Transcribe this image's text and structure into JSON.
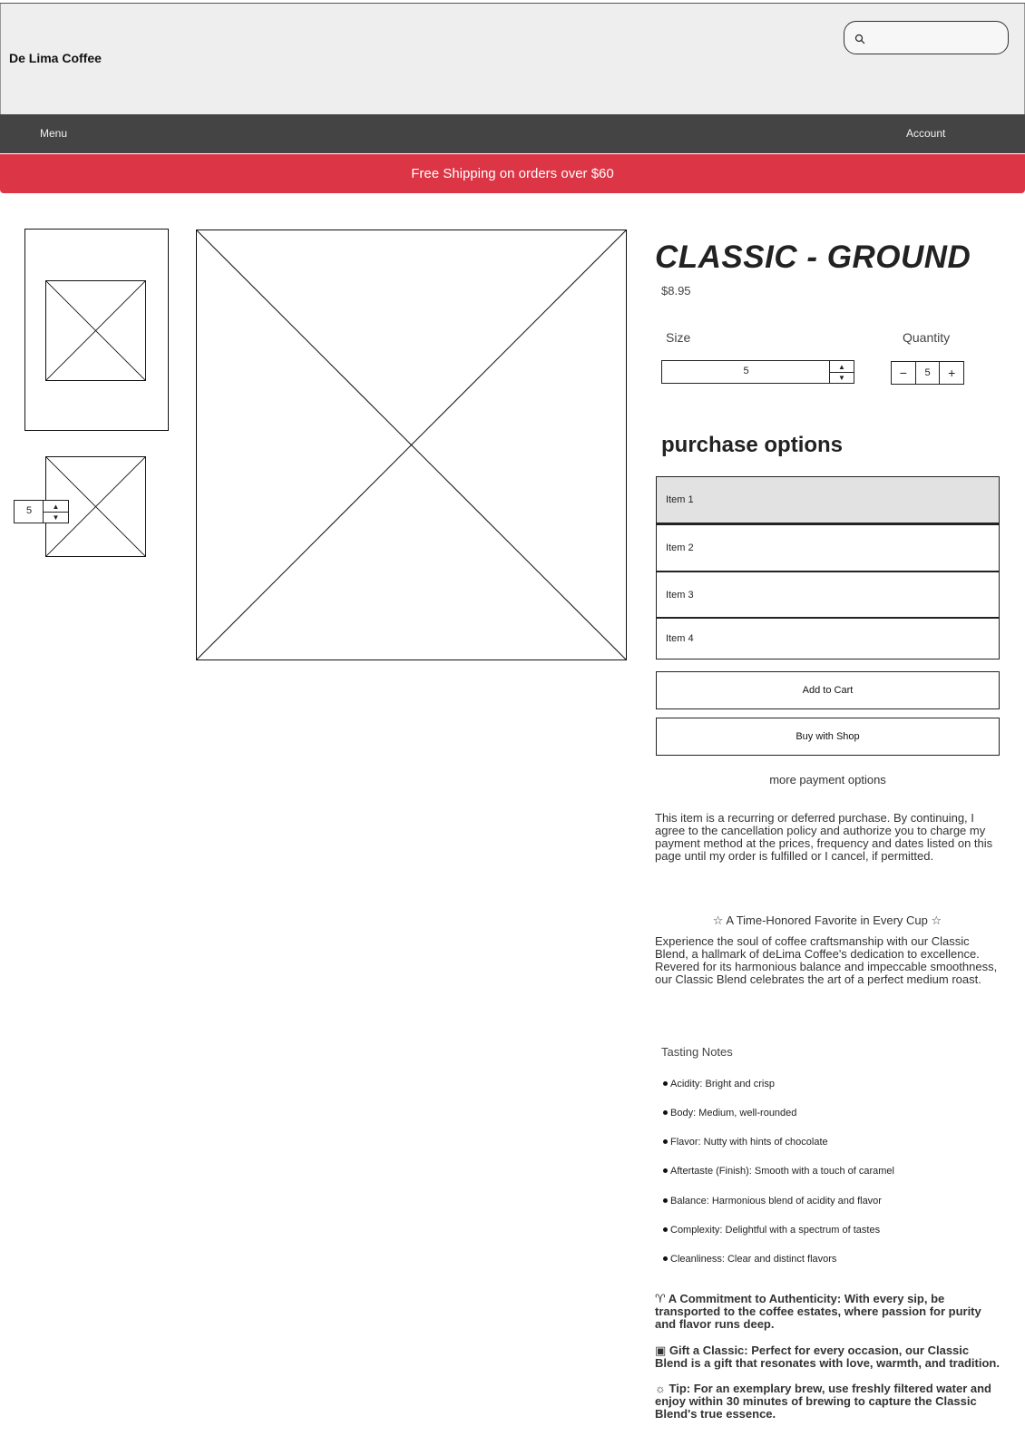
{
  "header": {
    "brand": "De Lima Coffee",
    "search": {
      "placeholder": "",
      "icon": "search-icon"
    }
  },
  "nav": {
    "menu_label": "Menu",
    "account_label": "Account"
  },
  "banner": {
    "text": "Free Shipping on orders over $60",
    "color": "#dc3545"
  },
  "gallery": {
    "thumbnail_stepper_value": "5"
  },
  "product": {
    "title": "CLASSIC - GROUND",
    "price": "$8.95",
    "size_label": "Size",
    "size_value": "5",
    "quantity_label": "Quantity",
    "quantity_value": "5",
    "decrement_glyph": "−",
    "increment_glyph": "+"
  },
  "purchase_options": {
    "title": "purchase options",
    "items": [
      "Item 1",
      "Item 2",
      "Item 3",
      "Item 4"
    ],
    "selected_index": 0
  },
  "actions": {
    "add_to_cart": "Add to Cart",
    "buy_with_shop": "Buy with Shop",
    "more_payment": "more payment options"
  },
  "disclaimer": "This item is a recurring or deferred purchase. By continuing, I agree to the cancellation policy and authorize you to charge my payment method at the prices, frequency and dates listed on this page until my order is fulfilled or I cancel, if permitted.",
  "description": {
    "favorite_heading": "A Time-Honored Favorite in Every Cup",
    "favorite_icon": "star-icon",
    "intro": "Experience the soul of coffee craftsmanship with our Classic Blend, a hallmark of deLima Coffee's dedication to excellence. Revered for its harmonious balance and impeccable smoothness, our Classic Blend celebrates the art of a perfect medium roast."
  },
  "tasting_notes": {
    "title": "Tasting Notes",
    "items": [
      "Acidity: Bright and crisp",
      "Body: Medium, well-rounded",
      "Flavor: Nutty with hints of chocolate",
      "Aftertaste (Finish): Smooth with a touch of caramel",
      "Balance: Harmonious blend of acidity and flavor",
      "Complexity: Delightful with a spectrum of tastes",
      "Cleanliness: Clear and distinct flavors"
    ]
  },
  "highlights": [
    {
      "icon": "plant-icon",
      "text": "A Commitment to Authenticity: With every sip, be transported to the coffee estates, where passion for purity and flavor runs deep."
    },
    {
      "icon": "gift-icon",
      "text": "Gift a Classic: Perfect for every occasion, our Classic Blend is a gift that resonates with love, warmth, and tradition."
    },
    {
      "icon": "lightbulb-icon",
      "text": "Tip: For an exemplary brew, use freshly filtered water and enjoy within 30 minutes of brewing to capture the Classic Blend's true essence."
    }
  ]
}
